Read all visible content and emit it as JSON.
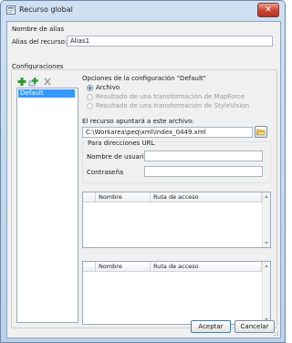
{
  "window": {
    "title": "Recurso global"
  },
  "alias_section": {
    "heading": "Nombre de alias",
    "label": "Alias del recurso:",
    "value": "Alias1"
  },
  "config_section": {
    "heading": "Configuraciones",
    "list_items": [
      "Default"
    ],
    "options_heading": "Opciones de la configuración \"Default\"",
    "radio_options": [
      {
        "label": "Archivo",
        "checked": true,
        "enabled": true
      },
      {
        "label": "Resultado de una transformación de MapForce",
        "checked": false,
        "enabled": false
      },
      {
        "label": "Resultado de una transformación de StyleVision",
        "checked": false,
        "enabled": false
      }
    ],
    "file_label": "El recurso apuntará a este archivo:",
    "file_value": "C:\\Workarea\\peq\\xml\\index_0449.xml",
    "url_heading": "Para direcciones URL",
    "username_label": "Nombre de usuario",
    "username_value": "",
    "password_label": "Contraseña",
    "password_value": "",
    "table1_headers": [
      "Nombre",
      "Ruta de acceso"
    ],
    "table2_headers": [
      "Nombre",
      "Ruta de acceso"
    ]
  },
  "buttons": {
    "ok": "Aceptar",
    "cancel": "Cancelar"
  },
  "icons": {
    "add_config": "add-green-plus-icon",
    "add_config_copy": "add-copy-green-plus-icon",
    "delete_config": "delete-icon",
    "browse": "folder-open-icon"
  }
}
